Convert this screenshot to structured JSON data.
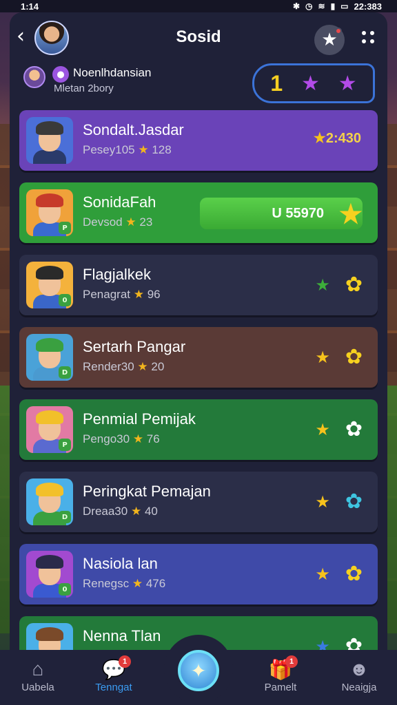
{
  "status_bar": {
    "time": "1:14",
    "right_text": "22:383"
  },
  "header": {
    "back": "‹",
    "title": "Sosid"
  },
  "sub_header": {
    "name": "Noenlhdansian",
    "status": "Mletan 2bory",
    "rank": "1"
  },
  "rows": [
    {
      "name": "Sondalt.Jasdar",
      "sub": "Pesey105",
      "sub_stat": "128",
      "score": "2:430",
      "type": "score",
      "bg": "#6a43b8",
      "avatar_bg": "#4b6fd8",
      "hair": "#3a3a3a",
      "body": "#2a3a6a",
      "badge": ""
    },
    {
      "name": "SonidaFah",
      "sub": "Devsod",
      "sub_stat": "23",
      "pill_value": "U 55970",
      "type": "pill",
      "bg": "#2f9e3a",
      "avatar_bg": "#f0a23a",
      "hair": "#c63a2a",
      "body": "#3a6ad0",
      "badge": "P"
    },
    {
      "name": "Flagjalkek",
      "sub": "Penagrat",
      "sub_stat": "96",
      "type": "stars",
      "bg": "#2b2e48",
      "avatar_bg": "#f4b23c",
      "hair": "#2a2a2a",
      "body": "#3a66c8",
      "badge": "0",
      "star1": "#3dae3a",
      "star2": "#f6d11f"
    },
    {
      "name": "Sertarh Pangar",
      "sub": "Render30",
      "sub_stat": "20",
      "type": "stars",
      "bg": "#5a3a36",
      "avatar_bg": "#4aa2d8",
      "hair": "#3aa040",
      "body": "#4a9ad0",
      "badge": "D",
      "star1": "#f6c21c",
      "star2": "#f6d11f"
    },
    {
      "name": "Penmial Pemijak",
      "sub": "Pengo30",
      "sub_stat": "76",
      "type": "stars",
      "bg": "#237a3a",
      "avatar_bg": "#e27aa4",
      "hair": "#f2c02a",
      "body": "#5a6ad0",
      "badge": "P",
      "star1": "#f6c21c",
      "star2": "#ffffff"
    },
    {
      "name": "Peringkat Pemajan",
      "sub": "Dreaa30",
      "sub_stat": "40",
      "type": "stars",
      "bg": "#2b2e48",
      "avatar_bg": "#4ab0e8",
      "hair": "#f2c02a",
      "body": "#3aa040",
      "badge": "D",
      "star1": "#f6c21c",
      "star2": "#3ec4e0"
    },
    {
      "name": "Nasiola lan",
      "sub": "Renegsc",
      "sub_stat": "476",
      "type": "stars",
      "bg": "#3f4aa8",
      "avatar_bg": "#a24ad0",
      "hair": "#2a2a4a",
      "body": "#3a5ad0",
      "badge": "0",
      "star1": "#f6c21c",
      "star2": "#f6d11f"
    },
    {
      "name": "Nenna Tlan",
      "sub": "",
      "sub_stat": "",
      "type": "stars",
      "bg": "#237a3a",
      "avatar_bg": "#4ab0e8",
      "hair": "#7a4a2a",
      "body": "#3a6ad0",
      "badge": "",
      "star1": "#3a7ae0",
      "star2": "#ffffff"
    }
  ],
  "nav": {
    "items": [
      {
        "label": "Uabela",
        "icon": "home-icon",
        "glyph": "⌂",
        "active": false,
        "badge": ""
      },
      {
        "label": "Tenngat",
        "icon": "chat-icon",
        "glyph": "💬",
        "active": true,
        "badge": "1"
      },
      {
        "label": "Pamelt",
        "icon": "gift-icon",
        "glyph": "🎁",
        "active": false,
        "badge": "1"
      },
      {
        "label": "Neaigja",
        "icon": "profile-icon",
        "glyph": "☻",
        "active": false,
        "badge": ""
      }
    ]
  },
  "colors": {
    "panel": "#1f2138",
    "accent_blue": "#3b9cf2",
    "gold": "#f6c21c",
    "purple_star": "#b24be8"
  }
}
